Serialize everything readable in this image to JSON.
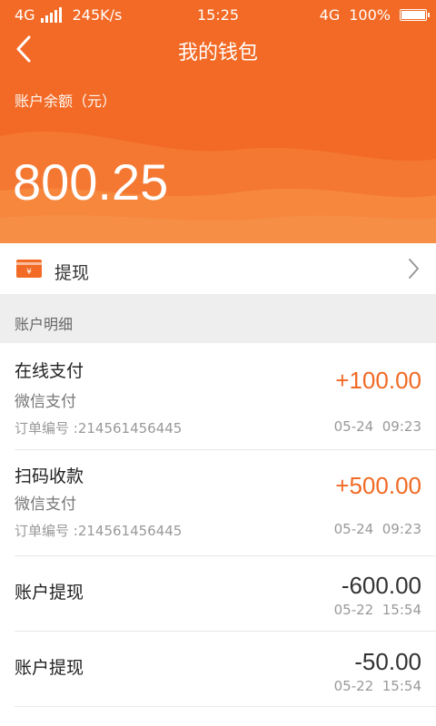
{
  "colors": {
    "accent": "#f26a25",
    "positive_amount": "#f06a24",
    "negative_amount": "#333333"
  },
  "status_bar": {
    "network": "4G",
    "speed": "245K/s",
    "time": "15:25",
    "network_right": "4G",
    "battery": "100%"
  },
  "header": {
    "back_icon": "chevron-left-icon",
    "title": "我的钱包",
    "balance_label": "账户余额（元）",
    "balance": "800.25"
  },
  "withdraw": {
    "icon": "wallet-icon",
    "label": "提现",
    "chevron": "chevron-right-icon"
  },
  "section": {
    "title": "账户明细"
  },
  "transactions": [
    {
      "title": "在线支付",
      "method": "微信支付",
      "order": "订单编号 :214561456445",
      "amount": "+100.00",
      "date": "05-24  09:23"
    },
    {
      "title": "扫码收款",
      "method": "微信支付",
      "order": "订单编号 :214561456445",
      "amount": "+500.00",
      "date": "05-24  09:23"
    },
    {
      "title": "账户提现",
      "amount": "-600.00",
      "date": "05-22  15:54"
    },
    {
      "title": "账户提现",
      "amount": "-50.00",
      "date": "05-22  15:54"
    }
  ]
}
